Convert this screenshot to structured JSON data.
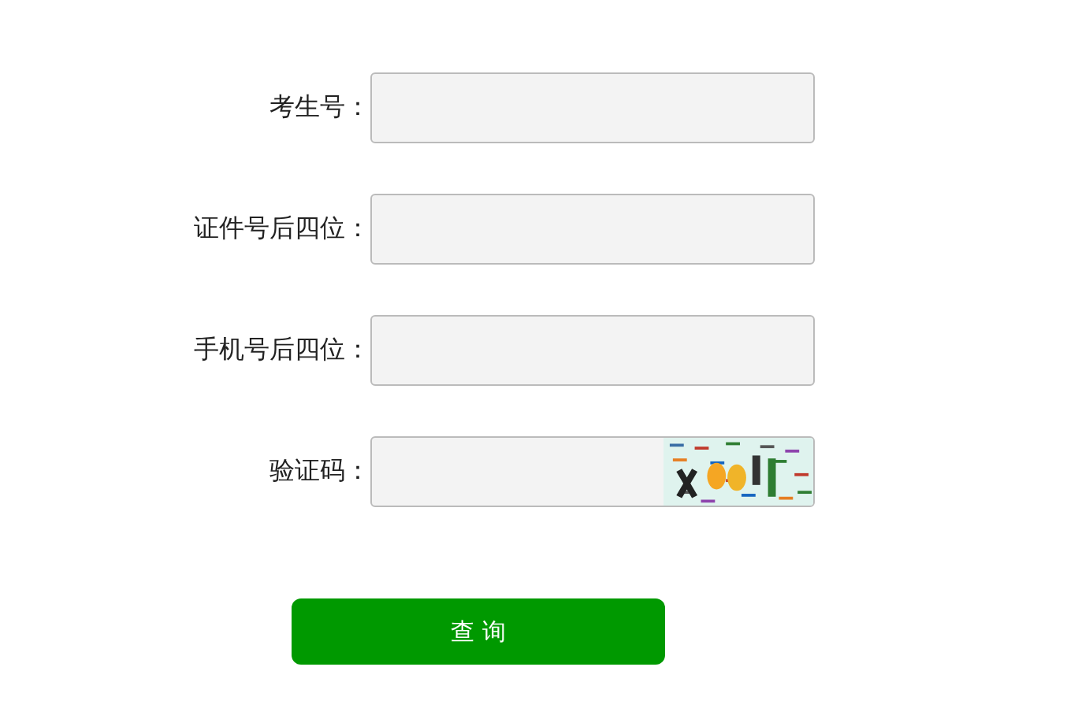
{
  "fields": [
    {
      "label": "考生号：",
      "kind": "text"
    },
    {
      "label": "证件号后四位：",
      "kind": "text"
    },
    {
      "label": "手机号后四位：",
      "kind": "text"
    },
    {
      "label": "验证码：",
      "kind": "captcha"
    }
  ],
  "submit": {
    "label": "查 询"
  }
}
